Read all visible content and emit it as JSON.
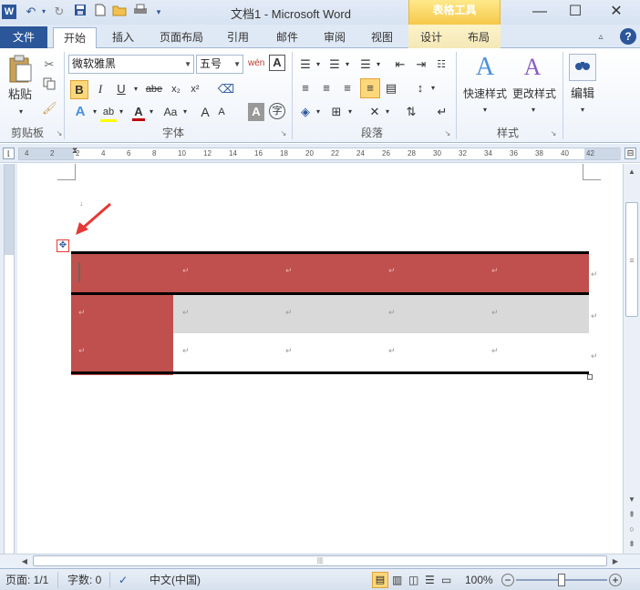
{
  "title_bar": {
    "title": "文档1 - Microsoft Word",
    "context_tab": "表格工具"
  },
  "tabs": {
    "file": "文件",
    "home": "开始",
    "insert": "插入",
    "page_layout": "页面布局",
    "references": "引用",
    "mailings": "邮件",
    "review": "审阅",
    "view": "视图",
    "design": "设计",
    "layout": "布局"
  },
  "ribbon": {
    "paste_label": "粘贴",
    "font_name": "微软雅黑",
    "font_size": "五号",
    "clipboard_group": "剪贴板",
    "font_group": "字体",
    "paragraph_group": "段落",
    "styles_group": "样式",
    "quick_styles": "快速样式",
    "change_styles": "更改样式",
    "edit_label": "编辑",
    "bold": "B",
    "italic": "I",
    "underline": "U",
    "strike": "abe",
    "subscript": "x₂",
    "superscript": "x²",
    "grow_font": "A",
    "shrink_font": "A",
    "change_case": "Aa",
    "font_color": "A",
    "wen": "wén",
    "char_border": "A",
    "char_shade": "A",
    "char_circle": "字"
  },
  "ruler": {
    "ticks": [
      "4",
      "2",
      "2",
      "4",
      "6",
      "8",
      "10",
      "12",
      "14",
      "16",
      "18",
      "20",
      "22",
      "24",
      "26",
      "28",
      "30",
      "32",
      "34",
      "36",
      "38",
      "40",
      "42"
    ]
  },
  "table": {
    "rows": 3,
    "cols": 5,
    "colors": {
      "red": "#c0504d",
      "gray": "#d9d9d9",
      "white": "#ffffff"
    }
  },
  "status_bar": {
    "page": "页面: 1/1",
    "words": "字数: 0",
    "language": "中文(中国)",
    "zoom": "100%"
  },
  "colors": {
    "file_tab": "#2b579a",
    "context_tab": "#f5c84a",
    "annotation_arrow": "#e53935"
  }
}
